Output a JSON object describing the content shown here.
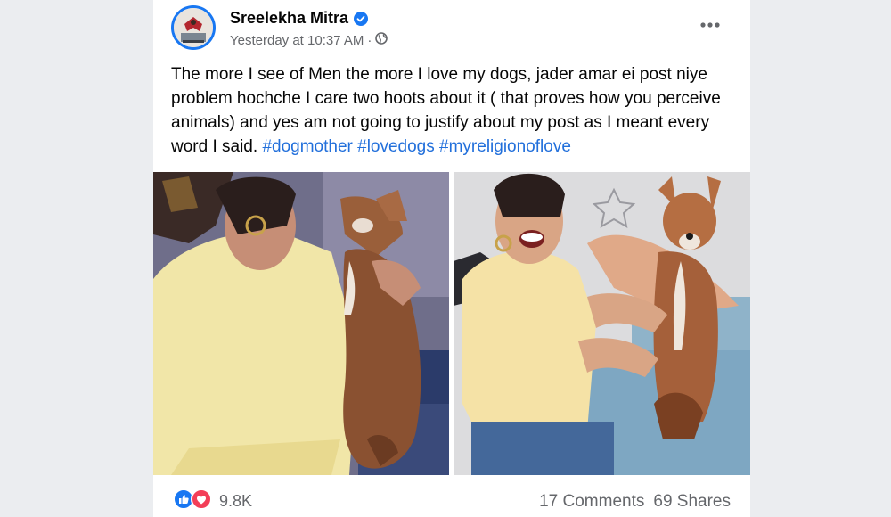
{
  "post": {
    "author": "Sreelekha Mitra",
    "timestamp": "Yesterday at 10:37 AM",
    "separator": "·",
    "text": "The more I see of Men the more I love my dogs, jader amar ei post niye problem hochche I care two hoots about it ( that proves how you perceive animals) and yes am not going to justify about my post as I meant every word I said. ",
    "hashtags": [
      "#dogmother",
      "#lovedogs",
      "#myreligionoflove"
    ]
  },
  "engagement": {
    "reaction_count": "9.8K",
    "comments": "17 Comments",
    "shares": "69 Shares"
  },
  "icons": {
    "verified": "verified-badge-icon",
    "audience": "globe-icon",
    "menu": "more-options-icon",
    "like": "like-reaction-icon",
    "love": "love-reaction-icon"
  },
  "colors": {
    "brand_blue": "#1877f2",
    "hashtag": "#216fdb",
    "love_red": "#f33e58",
    "meta_gray": "#65676b"
  }
}
